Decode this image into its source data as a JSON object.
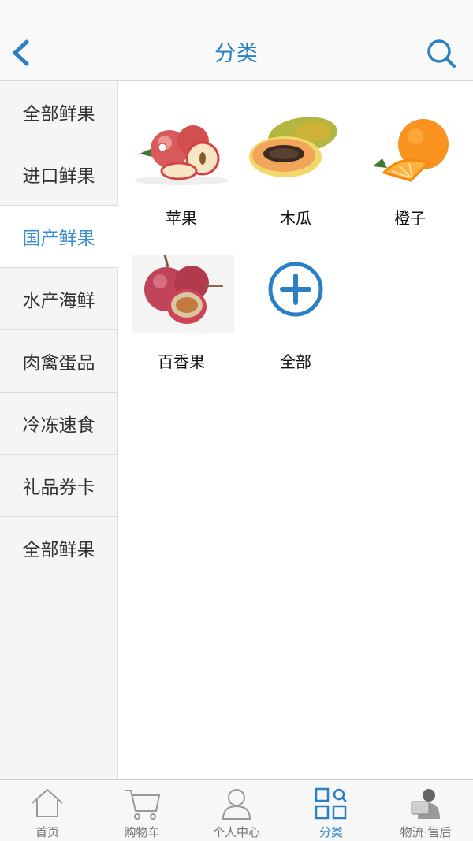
{
  "header": {
    "title": "分类",
    "back_icon": "chevron-left-icon",
    "search_icon": "search-icon"
  },
  "sidebar": {
    "items": [
      {
        "label": "全部鲜果",
        "active": false
      },
      {
        "label": "进口鲜果",
        "active": false
      },
      {
        "label": "国产鲜果",
        "active": true
      },
      {
        "label": "水产海鲜",
        "active": false
      },
      {
        "label": "肉禽蛋品",
        "active": false
      },
      {
        "label": "冷冻速食",
        "active": false
      },
      {
        "label": "礼品券卡",
        "active": false
      },
      {
        "label": "全部鲜果",
        "active": false
      }
    ]
  },
  "categories": [
    {
      "label": "苹果",
      "image": "apple-image"
    },
    {
      "label": "木瓜",
      "image": "papaya-image"
    },
    {
      "label": "橙子",
      "image": "orange-image"
    },
    {
      "label": "百香果",
      "image": "passion-fruit-image"
    },
    {
      "label": "全部",
      "image": "plus-circle-icon"
    }
  ],
  "tabbar": {
    "items": [
      {
        "label": "首页",
        "icon": "home-icon"
      },
      {
        "label": "购物车",
        "icon": "cart-icon"
      },
      {
        "label": "个人中心",
        "icon": "user-icon"
      },
      {
        "label": "分类",
        "icon": "grid-search-icon",
        "active": true
      },
      {
        "label": "物流·售后",
        "icon": "support-agent-icon"
      }
    ]
  },
  "colors": {
    "accent": "#2a7fc5",
    "active_side": "#3a8fd3",
    "text": "#333333"
  }
}
